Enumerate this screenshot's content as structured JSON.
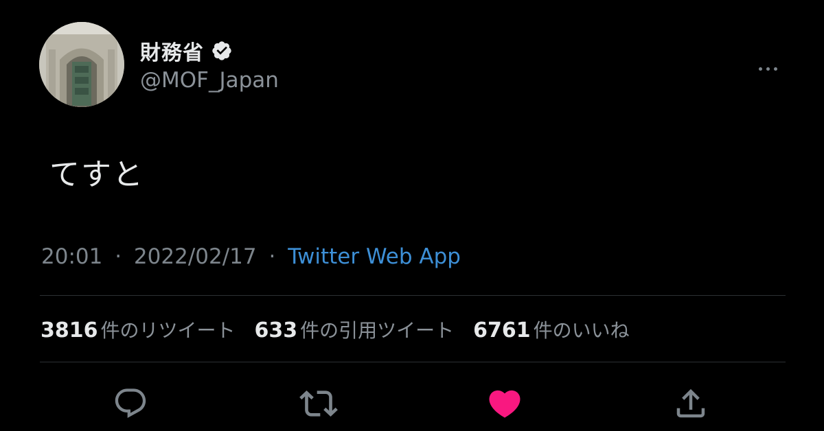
{
  "author": {
    "display_name": "財務省",
    "handle": "@MOF_Japan",
    "verified": true,
    "avatar": "building-photo"
  },
  "tweet": {
    "text": "てすと",
    "time": "20:01",
    "date": "2022/02/17",
    "separator": "·",
    "source": "Twitter Web App"
  },
  "stats": [
    {
      "count": "3816",
      "label": "件のリツイート"
    },
    {
      "count": "633",
      "label": "件の引用ツイート"
    },
    {
      "count": "6761",
      "label": "件のいいね"
    }
  ],
  "actions": [
    {
      "name": "reply",
      "icon": "speech-bubble-icon"
    },
    {
      "name": "retweet",
      "icon": "retweet-icon"
    },
    {
      "name": "like",
      "icon": "heart-icon",
      "active": true
    },
    {
      "name": "share",
      "icon": "share-icon"
    }
  ],
  "colors": {
    "background": "#000000",
    "text": "#e7e9ea",
    "secondary": "#8b9299",
    "link": "#3d8fd6",
    "like": "#f91880",
    "divider": "#2c3034"
  }
}
